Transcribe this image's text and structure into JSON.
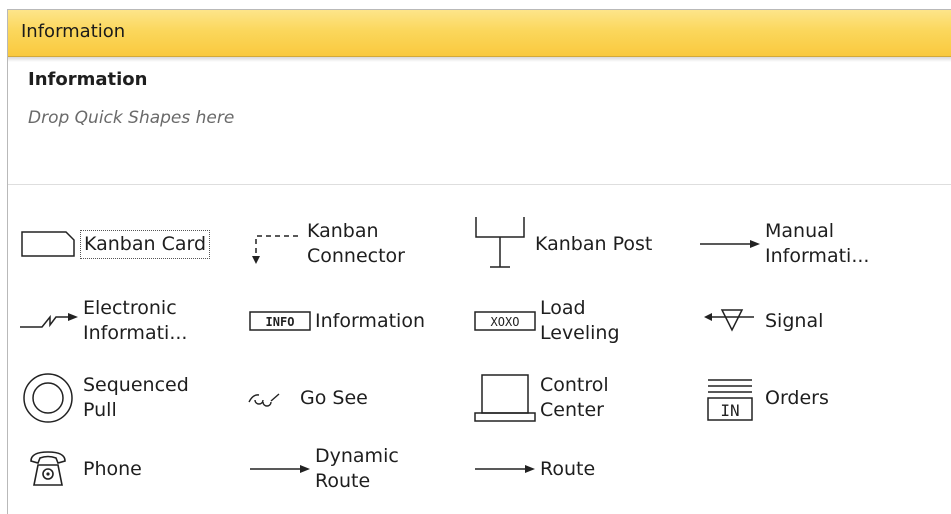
{
  "panel": {
    "header_title": "Information",
    "stencil_title": "Information",
    "drop_hint": "Drop Quick Shapes here"
  },
  "shapes": [
    {
      "label": "Kanban Card",
      "icon": "kanban-card-icon"
    },
    {
      "label": "Kanban\nConnector",
      "icon": "kanban-connector-icon"
    },
    {
      "label": "Kanban Post",
      "icon": "kanban-post-icon"
    },
    {
      "label": "Manual\nInformati...",
      "icon": "manual-information-icon"
    },
    {
      "label": "Electronic\nInformati...",
      "icon": "electronic-information-icon"
    },
    {
      "label": "Information",
      "icon": "information-icon",
      "icon_text": "INFO"
    },
    {
      "label": "Load\nLeveling",
      "icon": "load-leveling-icon",
      "icon_text": "XOXO"
    },
    {
      "label": "Signal",
      "icon": "signal-icon"
    },
    {
      "label": "Sequenced\nPull",
      "icon": "sequenced-pull-icon"
    },
    {
      "label": "Go See",
      "icon": "go-see-icon"
    },
    {
      "label": "Control\nCenter",
      "icon": "control-center-icon"
    },
    {
      "label": "Orders",
      "icon": "orders-icon",
      "icon_text": "IN"
    },
    {
      "label": "Phone",
      "icon": "phone-icon"
    },
    {
      "label": "Dynamic\nRoute",
      "icon": "dynamic-route-icon"
    },
    {
      "label": "Route",
      "icon": "route-icon"
    }
  ],
  "colors": {
    "header": "#f9c93e",
    "header_light": "#fde58a"
  }
}
